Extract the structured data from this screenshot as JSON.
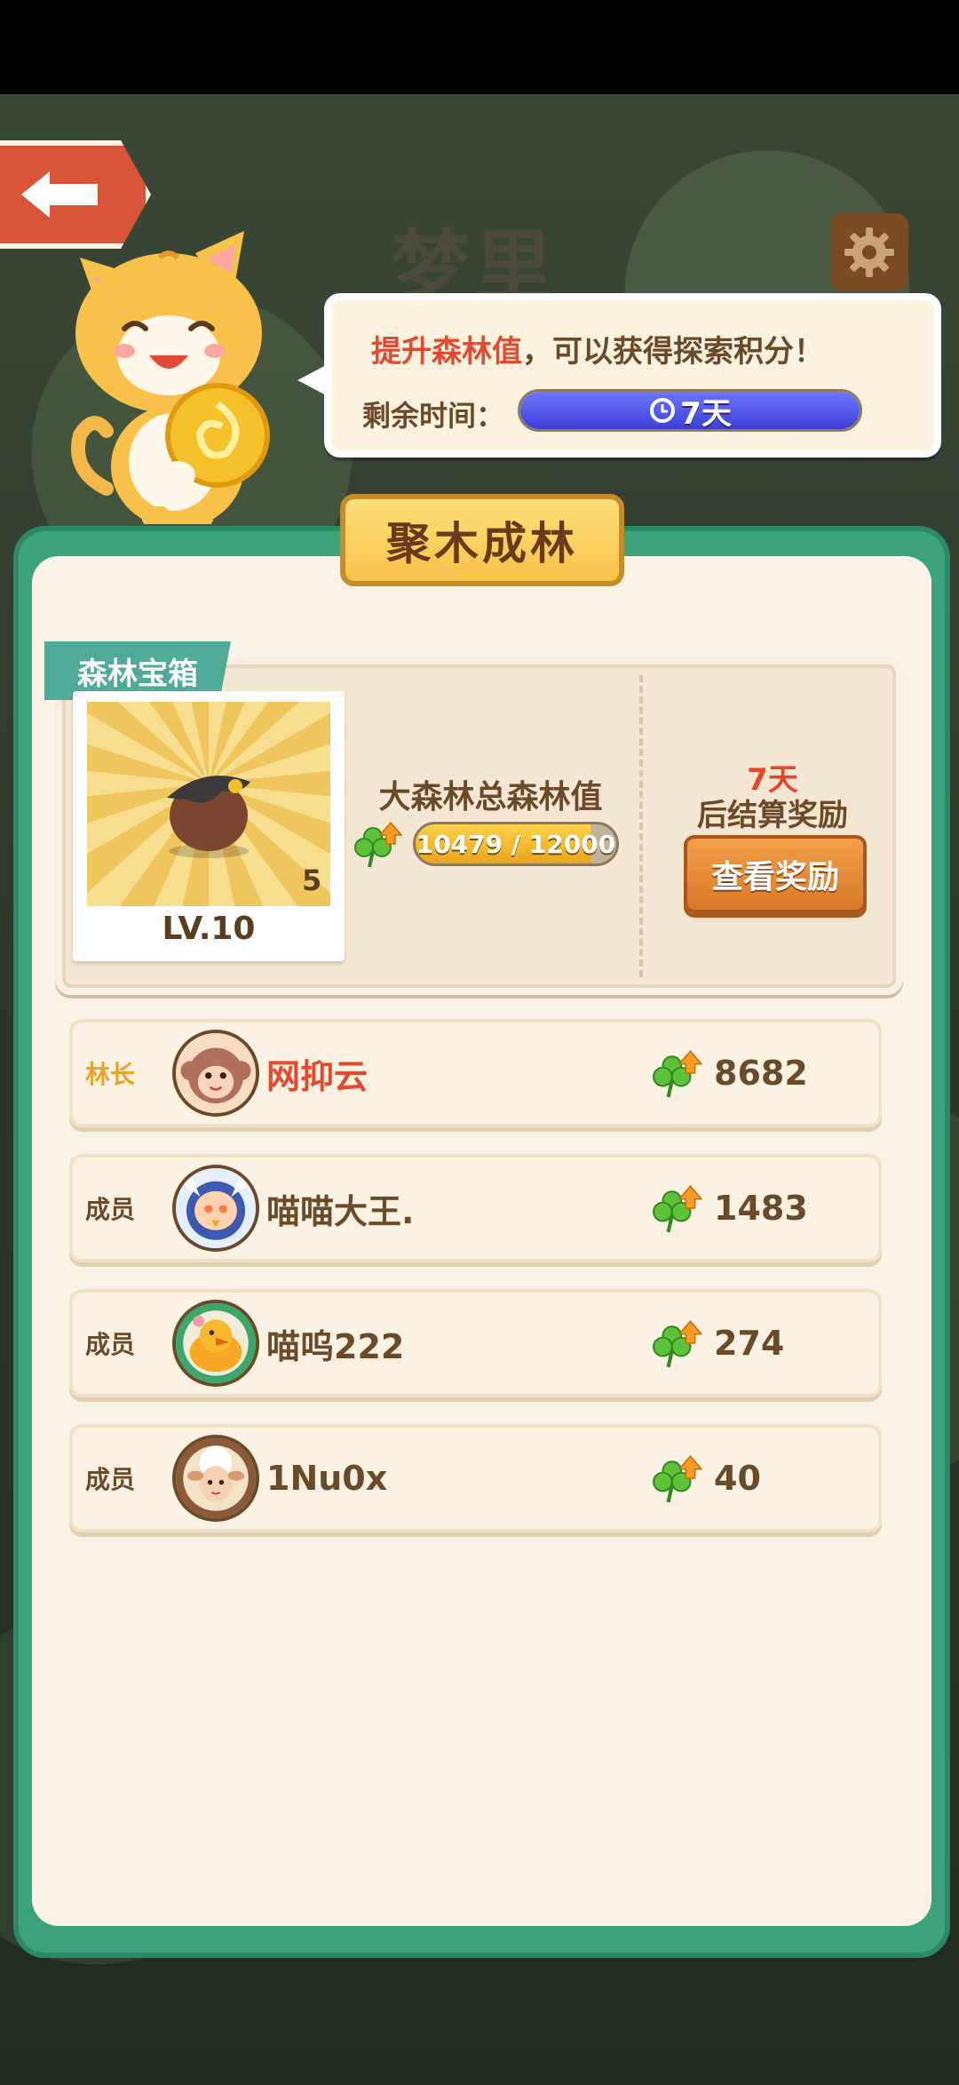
{
  "header": {
    "back_icon": "back-arrow-icon",
    "title": "梦里",
    "settings_icon": "gear-icon"
  },
  "bubble": {
    "line1_highlight": "提升森林值",
    "line1_rest": "，可以获得探索积分！",
    "time_label": "剩余时间：",
    "time_value": "7天",
    "time_fraction": 1.0
  },
  "panel": {
    "title": "聚木成林"
  },
  "chest": {
    "tag": "森林宝箱",
    "count": "5",
    "level": "LV.10",
    "forest_label": "大森林总森林值",
    "progress_text": "10479 / 12000",
    "progress_value": 10479,
    "progress_max": 12000,
    "days": "7天",
    "settle_text": "后结算奖励",
    "view_button": "查看奖励"
  },
  "members": [
    {
      "role": "林长",
      "role_color": "#e8a52a",
      "name": "网抑云",
      "name_color": "#e44a2f",
      "score": "8682",
      "avatar": "monkey-avatar"
    },
    {
      "role": "成员",
      "role_color": "#6b4a2a",
      "name": "喵喵大王.",
      "name_color": "#6b4a2a",
      "score": "1483",
      "avatar": "bird-avatar"
    },
    {
      "role": "成员",
      "role_color": "#6b4a2a",
      "name": "喵呜222",
      "name_color": "#6b4a2a",
      "score": "274",
      "avatar": "duck-avatar"
    },
    {
      "role": "成员",
      "role_color": "#6b4a2a",
      "name": "1Nu0x",
      "name_color": "#6b4a2a",
      "score": "40",
      "avatar": "sheep-avatar"
    }
  ]
}
